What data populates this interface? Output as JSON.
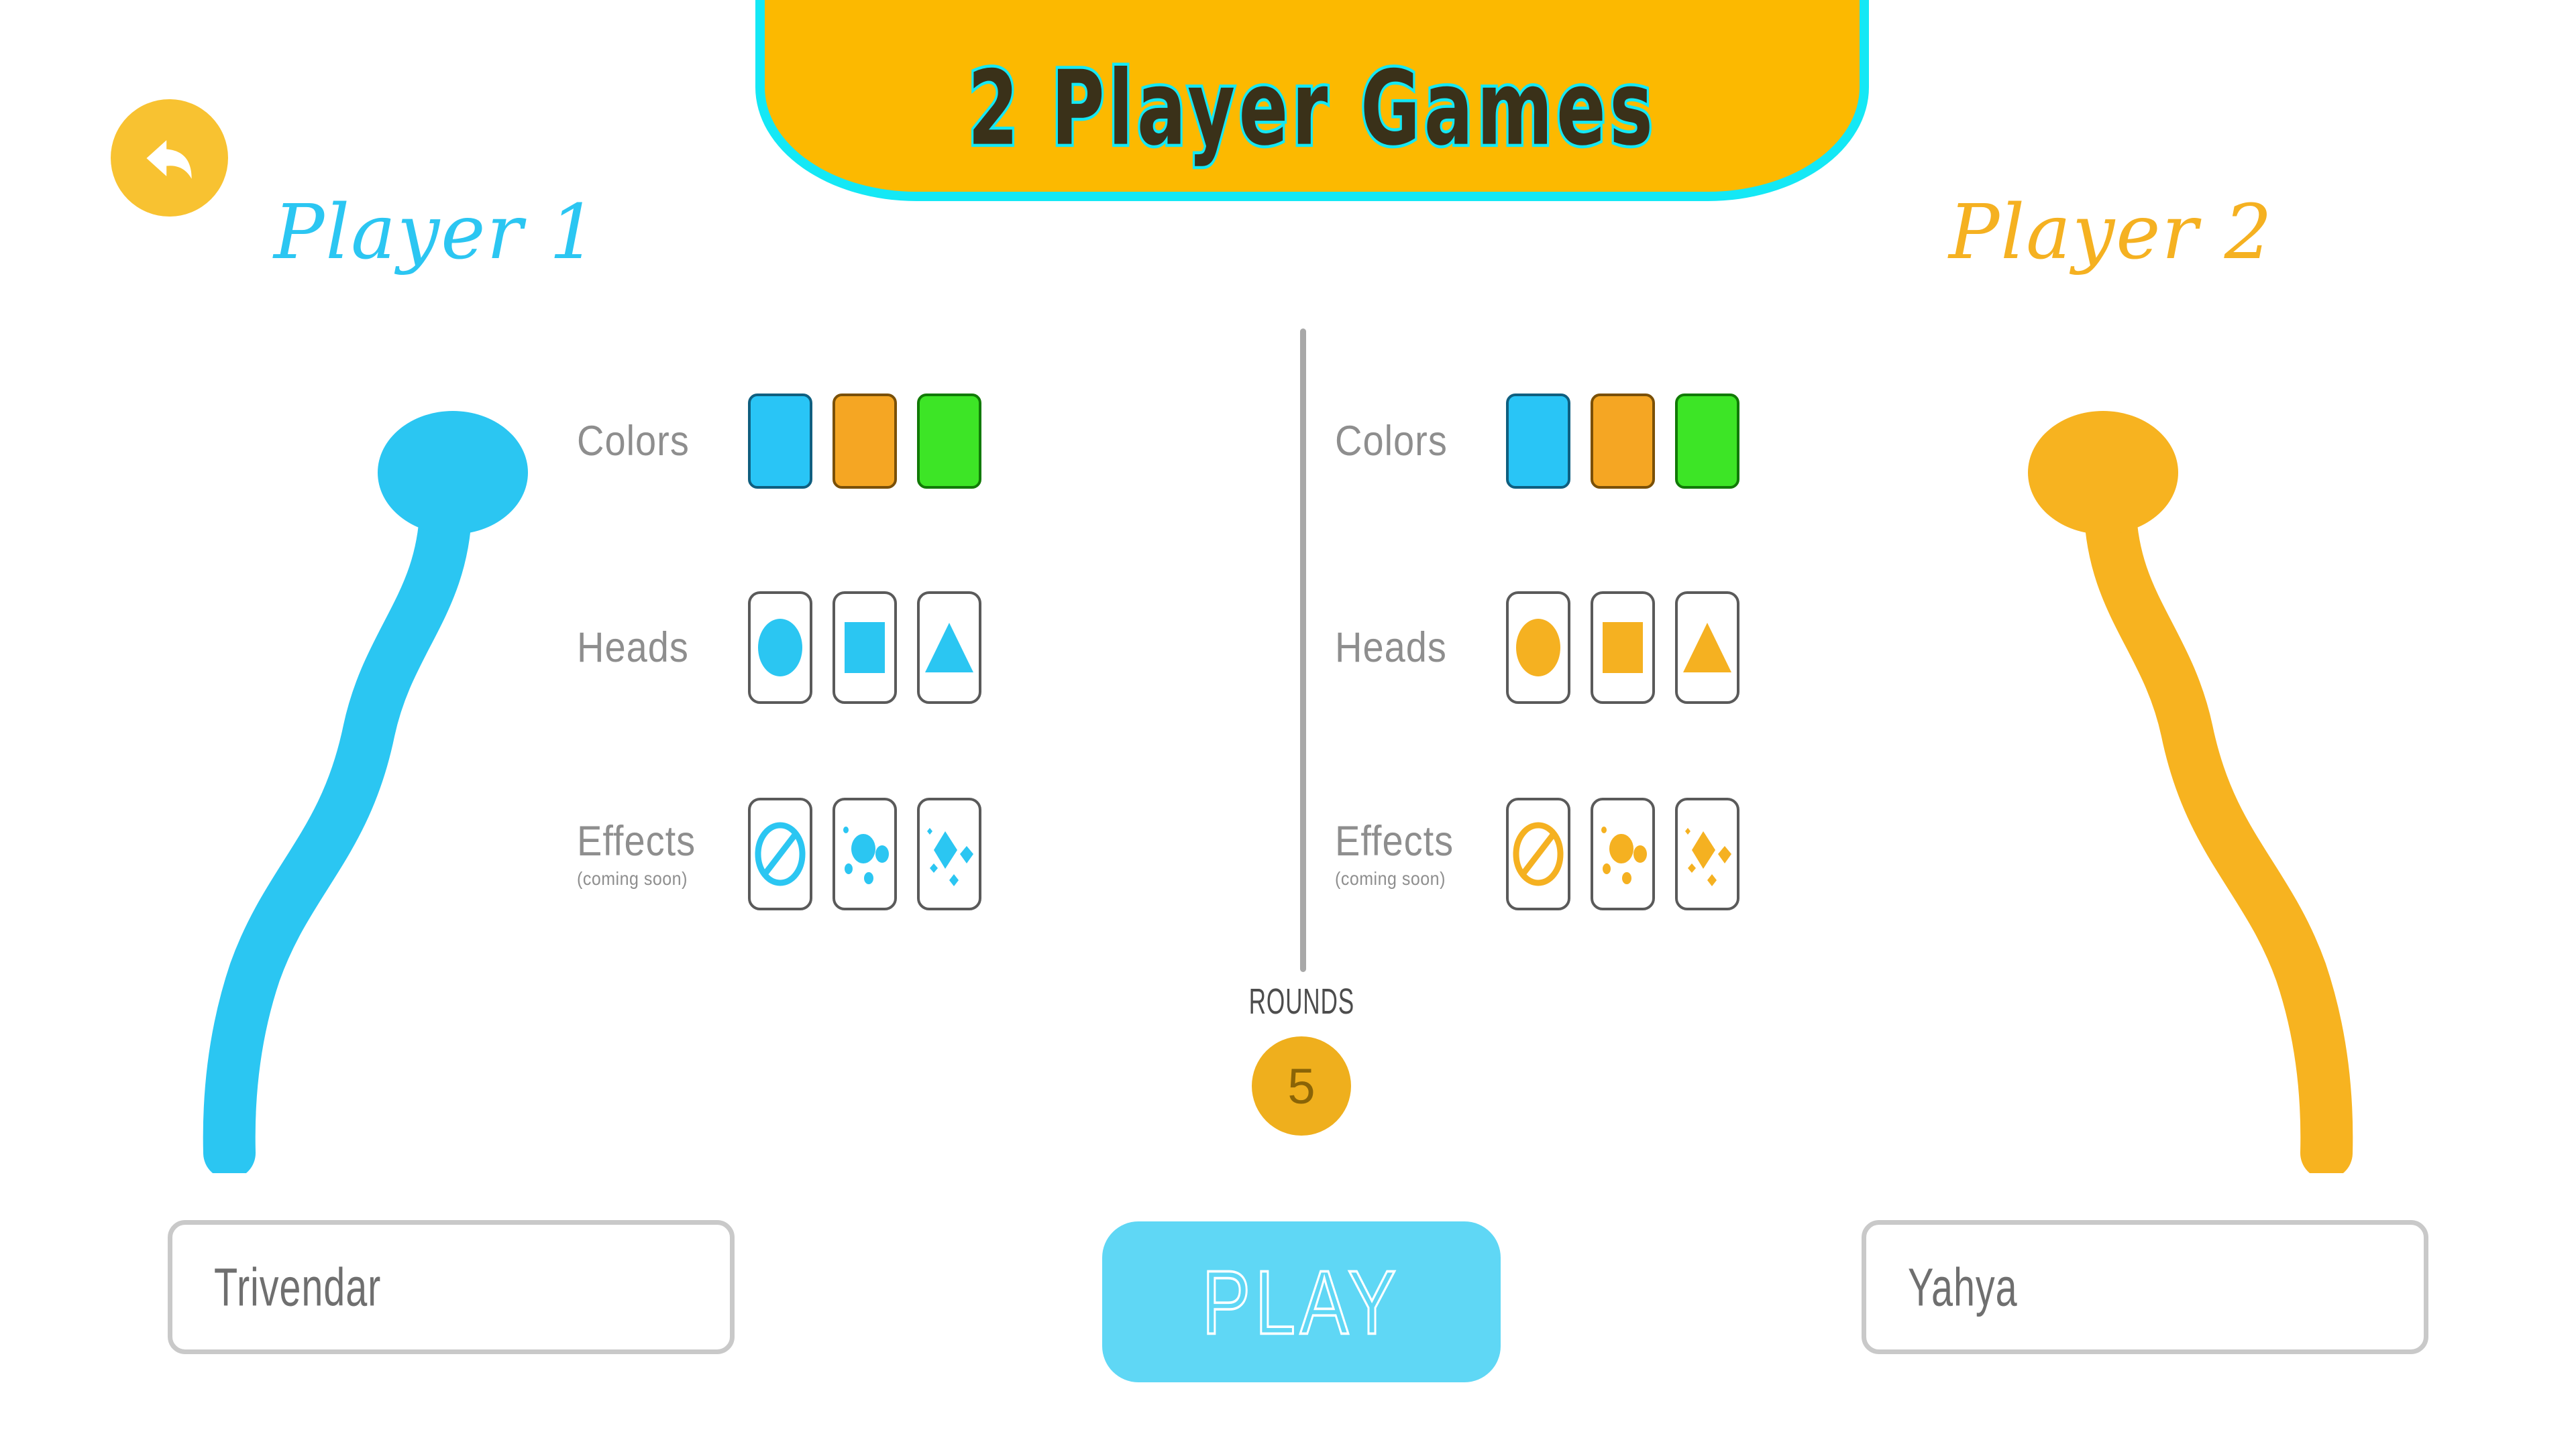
{
  "header": {
    "title": "2 Player Games",
    "banner_fill": "#FCB900",
    "banner_border": "#14E8F5",
    "title_color": "#3a3119",
    "back_button": {
      "name": "back",
      "icon": "back-arrow-icon",
      "fill": "#F8C231"
    }
  },
  "divider": {
    "color": "#a8a8a8"
  },
  "players": [
    {
      "heading": "Player 1",
      "accent": "#2BC6F2",
      "snake_color": "#2BC6F2",
      "name_value": "Trivendar",
      "name_placeholder": "Trivendar",
      "options": {
        "colors": {
          "label": "Colors",
          "choices": [
            {
              "icon": "color-swatch-cyan",
              "fill": "#29C5F6",
              "border": "#0f5f80",
              "selected": true
            },
            {
              "icon": "color-swatch-orange",
              "fill": "#F5A623",
              "border": "#7a5007",
              "selected": false
            },
            {
              "icon": "color-swatch-green",
              "fill": "#3DE526",
              "border": "#117a06",
              "selected": false
            }
          ]
        },
        "heads": {
          "label": "Heads",
          "choices": [
            {
              "icon": "head-circle-icon",
              "shape": "circle",
              "selected": true
            },
            {
              "icon": "head-square-icon",
              "shape": "square",
              "selected": false
            },
            {
              "icon": "head-triangle-icon",
              "shape": "triangle",
              "selected": false
            }
          ]
        },
        "effects": {
          "label": "Effects",
          "sublabel": "(coming soon)",
          "choices": [
            {
              "icon": "effect-none-icon",
              "shape": "none",
              "selected": true
            },
            {
              "icon": "effect-bubbles-icon",
              "shape": "bubbles",
              "selected": false
            },
            {
              "icon": "effect-sparkles-icon",
              "shape": "sparkles",
              "selected": false
            }
          ]
        }
      }
    },
    {
      "heading": "Player 2",
      "accent": "#F5B121",
      "snake_color": "#F7B320",
      "name_value": "Yahya",
      "name_placeholder": "Yahya",
      "options": {
        "colors": {
          "label": "Colors",
          "choices": [
            {
              "icon": "color-swatch-cyan",
              "fill": "#29C5F6",
              "border": "#0f5f80",
              "selected": false
            },
            {
              "icon": "color-swatch-orange",
              "fill": "#F5A623",
              "border": "#7a5007",
              "selected": true
            },
            {
              "icon": "color-swatch-green",
              "fill": "#3DE526",
              "border": "#117a06",
              "selected": false
            }
          ]
        },
        "heads": {
          "label": "Heads",
          "choices": [
            {
              "icon": "head-circle-icon",
              "shape": "circle",
              "selected": true
            },
            {
              "icon": "head-square-icon",
              "shape": "square",
              "selected": false
            },
            {
              "icon": "head-triangle-icon",
              "shape": "triangle",
              "selected": false
            }
          ]
        },
        "effects": {
          "label": "Effects",
          "sublabel": "(coming soon)",
          "choices": [
            {
              "icon": "effect-none-icon",
              "shape": "none",
              "selected": true
            },
            {
              "icon": "effect-bubbles-icon",
              "shape": "bubbles",
              "selected": false
            },
            {
              "icon": "effect-sparkles-icon",
              "shape": "sparkles",
              "selected": false
            }
          ]
        }
      }
    }
  ],
  "rounds": {
    "label": "ROUNDS",
    "value": "5",
    "circle_fill": "#EFAF1D"
  },
  "play": {
    "label": "PLAY",
    "fill": "#5FD7F5"
  }
}
